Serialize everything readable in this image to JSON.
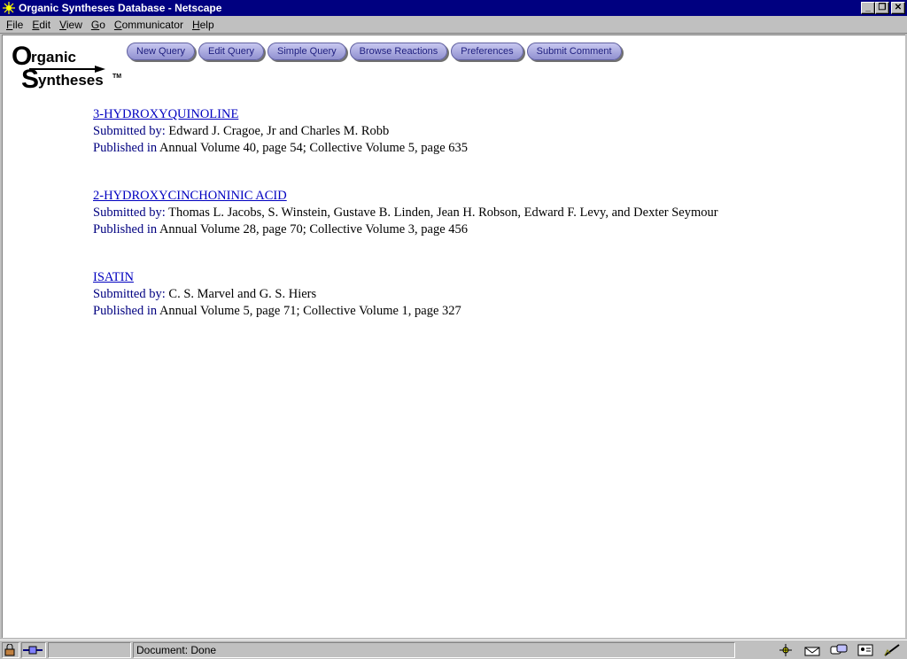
{
  "window": {
    "title": "Organic Syntheses Database - Netscape",
    "controls": {
      "minimize": "_",
      "restore": "❐",
      "close": "✕"
    }
  },
  "menu": [
    {
      "ul": "F",
      "rest": "ile"
    },
    {
      "ul": "E",
      "rest": "dit"
    },
    {
      "ul": "V",
      "rest": "iew"
    },
    {
      "ul": "G",
      "rest": "o"
    },
    {
      "ul": "C",
      "rest": "ommunicator"
    },
    {
      "ul": "H",
      "rest": "elp"
    }
  ],
  "logo": {
    "line1": "rganic",
    "line2": "yntheses",
    "big1": "O",
    "big2": "S",
    "tm": "TM"
  },
  "nav": {
    "new_query": "New Query",
    "edit_query": "Edit Query",
    "simple_query": "Simple Query",
    "browse_reactions": "Browse Reactions",
    "preferences": "Preferences",
    "submit_comment": "Submit Comment"
  },
  "labels": {
    "submitted_by": "Submitted by:",
    "published_in": "Published in"
  },
  "results": [
    {
      "title": "3-HYDROXYQUINOLINE",
      "submitted": "Edward J. Cragoe, Jr and Charles M. Robb",
      "published": "Annual Volume 40, page 54; Collective Volume 5, page 635"
    },
    {
      "title": "2-HYDROXYCINCHONINIC ACID",
      "submitted": "Thomas L. Jacobs, S. Winstein, Gustave B. Linden, Jean H. Robson, Edward F. Levy, and Dexter Seymour",
      "published": "Annual Volume 28, page 70; Collective Volume 3, page 456"
    },
    {
      "title": "ISATIN",
      "submitted": "C. S. Marvel and G. S. Hiers",
      "published": "Annual Volume 5, page 71; Collective Volume 1, page 327"
    }
  ],
  "status": {
    "text": "Document: Done"
  },
  "colors": {
    "titlebar": "#000080",
    "link": "#0000c0",
    "label": "#000080",
    "chrome": "#c0c0c0"
  }
}
